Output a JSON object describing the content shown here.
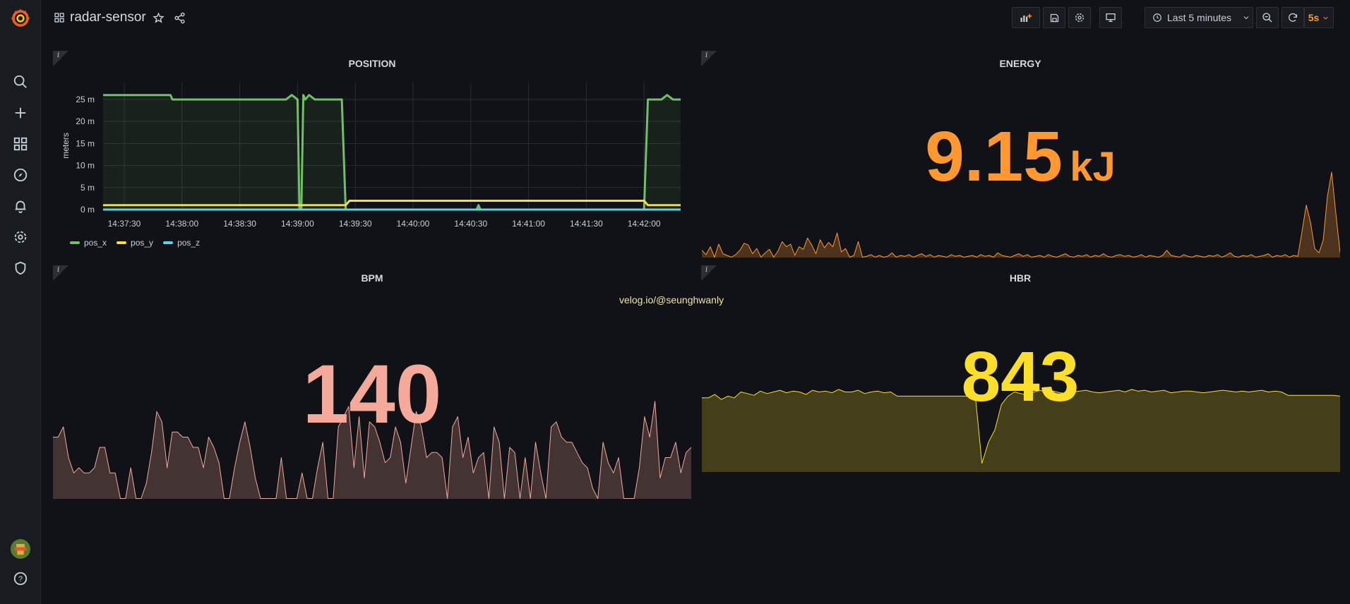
{
  "app": {
    "dashboard_title": "radar-sensor"
  },
  "topbar": {
    "time_range": "Last 5 minutes",
    "refresh_interval": "5s"
  },
  "icons": {
    "sidemenu": [
      "grafana-logo-icon",
      "search-icon",
      "plus-icon",
      "dashboards-icon",
      "explore-compass-icon",
      "alerting-bell-icon",
      "configuration-gear-icon",
      "server-admin-shield-icon",
      "avatar",
      "help-icon"
    ]
  },
  "panels": {
    "position": {
      "title": "POSITION",
      "info": "i",
      "legend": [
        {
          "name": "pos_x",
          "color": "#73bf69"
        },
        {
          "name": "pos_y",
          "color": "#fade2a"
        },
        {
          "name": "pos_z",
          "color": "#5ad3e6"
        }
      ]
    },
    "energy": {
      "title": "ENERGY",
      "info": "i",
      "value": "9.15",
      "unit": "kJ",
      "color": "#ff9830"
    },
    "bpm": {
      "title": "BPM",
      "info": "i",
      "value": "140",
      "color": "#f4a99b"
    },
    "hbr": {
      "title": "HBR",
      "info": "i",
      "value": "843",
      "color": "#fade2a"
    }
  },
  "watermark": "velog.io/@seunghwanly",
  "chart_data": [
    {
      "type": "line",
      "title": "POSITION",
      "ylabel": "meters",
      "y_ticks": [
        "0 m",
        "5 m",
        "10 m",
        "15 m",
        "20 m",
        "25 m"
      ],
      "ylim": [
        0,
        29
      ],
      "x_ticks": [
        "14:37:30",
        "14:38:00",
        "14:38:30",
        "14:39:00",
        "14:39:30",
        "14:40:00",
        "14:40:30",
        "14:41:00",
        "14:41:30",
        "14:42:00"
      ],
      "xlim": [
        "14:37:19",
        "14:42:19"
      ],
      "grid": true,
      "legend_position": "bottom-left",
      "series": [
        {
          "name": "pos_x",
          "color": "#73bf69",
          "fill": true,
          "points": [
            [
              "14:37:19",
              26
            ],
            [
              "14:37:54",
              26
            ],
            [
              "14:37:55",
              25
            ],
            [
              "14:38:54",
              25
            ],
            [
              "14:38:57",
              26
            ],
            [
              "14:39:00",
              25
            ],
            [
              "14:39:01",
              0
            ],
            [
              "14:39:02",
              0
            ],
            [
              "14:39:03",
              26
            ],
            [
              "14:39:04",
              25
            ],
            [
              "14:39:06",
              26
            ],
            [
              "14:39:09",
              25
            ],
            [
              "14:39:23",
              25
            ],
            [
              "14:39:25",
              0
            ],
            [
              "14:40:33",
              0
            ],
            [
              "14:40:34",
              1
            ],
            [
              "14:40:35",
              0
            ],
            [
              "14:42:00",
              0
            ],
            [
              "14:42:02",
              25
            ],
            [
              "14:42:09",
              25
            ],
            [
              "14:42:12",
              26
            ],
            [
              "14:42:15",
              25
            ],
            [
              "14:42:19",
              25
            ]
          ]
        },
        {
          "name": "pos_y",
          "color": "#fade2a",
          "fill": false,
          "points": [
            [
              "14:37:19",
              1
            ],
            [
              "14:39:25",
              1
            ],
            [
              "14:39:27",
              2
            ],
            [
              "14:42:00",
              2
            ],
            [
              "14:42:02",
              1
            ],
            [
              "14:42:19",
              1
            ]
          ]
        },
        {
          "name": "pos_z",
          "color": "#5ad3e6",
          "fill": false,
          "points": [
            [
              "14:37:19",
              0
            ],
            [
              "14:42:19",
              0
            ]
          ]
        }
      ]
    },
    {
      "type": "area",
      "title": "ENERGY",
      "ylim": [
        0,
        100
      ],
      "color": "#ff9830",
      "values": [
        8,
        3,
        12,
        0,
        15,
        4,
        2,
        0,
        3,
        8,
        16,
        14,
        4,
        10,
        0,
        5,
        9,
        0,
        7,
        18,
        12,
        15,
        2,
        12,
        9,
        22,
        14,
        4,
        20,
        11,
        17,
        12,
        28,
        6,
        10,
        0,
        2,
        18,
        0,
        1,
        3,
        0,
        2,
        0,
        1,
        5,
        0,
        2,
        1,
        3,
        0,
        2,
        4,
        1,
        3,
        0,
        2,
        1,
        0,
        3,
        1,
        2,
        0,
        1,
        2,
        0,
        3,
        1,
        2,
        0,
        5,
        2,
        1,
        0,
        2,
        4,
        1,
        3,
        0,
        1,
        2,
        0,
        3,
        1,
        0,
        2,
        4,
        1,
        0,
        2,
        1,
        3,
        0,
        2,
        1,
        4,
        1,
        0,
        2,
        3,
        1,
        2,
        0,
        1,
        3,
        0,
        2,
        1,
        0,
        2,
        8,
        2,
        1,
        0,
        3,
        1,
        0,
        2,
        1,
        0,
        2,
        1,
        3,
        0,
        2,
        5,
        1,
        0,
        2,
        1,
        3,
        0,
        1,
        2,
        4,
        0,
        2,
        1,
        3,
        0,
        2,
        1,
        30,
        60,
        40,
        10,
        5,
        20,
        70,
        98,
        50,
        5
      ]
    },
    {
      "type": "area",
      "title": "BPM",
      "ylim": [
        0,
        100
      ],
      "color": "#f4a99b",
      "values": [
        60,
        60,
        70,
        40,
        25,
        30,
        25,
        25,
        30,
        50,
        50,
        25,
        25,
        0,
        0,
        30,
        0,
        0,
        15,
        45,
        85,
        75,
        30,
        65,
        65,
        60,
        60,
        50,
        50,
        30,
        60,
        50,
        35,
        0,
        0,
        30,
        55,
        75,
        50,
        20,
        0,
        0,
        0,
        0,
        40,
        0,
        0,
        0,
        25,
        0,
        0,
        30,
        55,
        0,
        0,
        70,
        80,
        90,
        30,
        80,
        20,
        75,
        70,
        55,
        35,
        40,
        70,
        55,
        15,
        50,
        85,
        70,
        40,
        45,
        45,
        40,
        0,
        70,
        80,
        40,
        60,
        25,
        40,
        45,
        0,
        70,
        55,
        0,
        50,
        45,
        0,
        40,
        0,
        55,
        25,
        0,
        70,
        75,
        60,
        55,
        55,
        45,
        35,
        30,
        10,
        0,
        55,
        35,
        25,
        40,
        0,
        0,
        0,
        30,
        80,
        60,
        95,
        20,
        40,
        40,
        55,
        25,
        45,
        50
      ]
    },
    {
      "type": "area",
      "title": "HBR",
      "ylim": [
        0,
        100
      ],
      "color": "#fade2a",
      "values": [
        88,
        88,
        92,
        86,
        90,
        88,
        95,
        93,
        91,
        96,
        93,
        95,
        97,
        94,
        96,
        95,
        92,
        97,
        95,
        96,
        94,
        98,
        95,
        95,
        97,
        93,
        95,
        96,
        94,
        95,
        90,
        90,
        90,
        90,
        90,
        90,
        90,
        90,
        90,
        90,
        90,
        90,
        90,
        10,
        35,
        50,
        80,
        90,
        95,
        93,
        91,
        95,
        97,
        93,
        96,
        94,
        93,
        95,
        96,
        97,
        95,
        94,
        95,
        96,
        97,
        95,
        98,
        96,
        97,
        95,
        96,
        97,
        94,
        95,
        96,
        96,
        95,
        94,
        95,
        96,
        97,
        96,
        95,
        96,
        95,
        96,
        97,
        95,
        96,
        95,
        91,
        91,
        91,
        91,
        91,
        91,
        91,
        91,
        90
      ]
    }
  ]
}
